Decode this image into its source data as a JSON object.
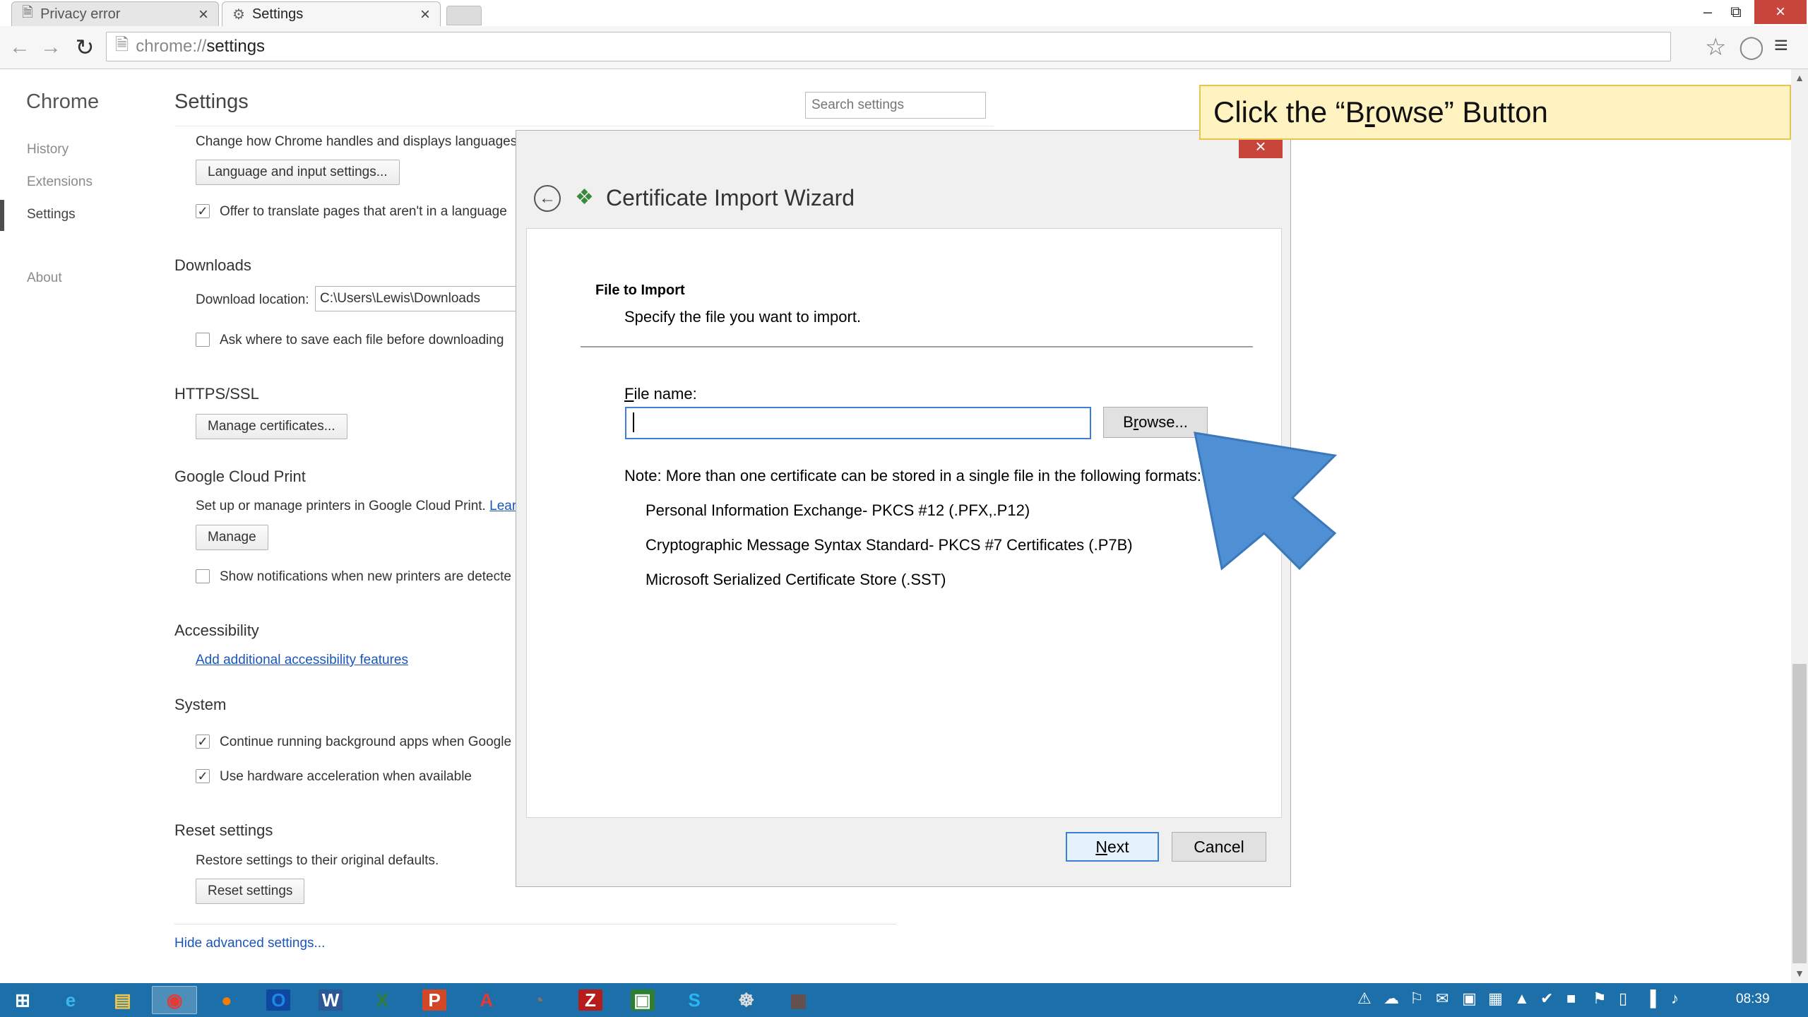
{
  "tabs": [
    {
      "label": "Privacy error",
      "icon": "page-icon"
    },
    {
      "label": "Settings",
      "icon": "gear-icon"
    }
  ],
  "omnibox": {
    "scheme": "chrome://",
    "host": "settings"
  },
  "nav": {
    "title": "Chrome",
    "items": [
      {
        "label": "History"
      },
      {
        "label": "Extensions"
      },
      {
        "label": "Settings"
      },
      {
        "label": "About"
      }
    ]
  },
  "settings": {
    "title": "Settings",
    "search_placeholder": "Search settings",
    "languages": {
      "desc": "Change how Chrome handles and displays languages.",
      "button": "Language and input settings...",
      "translate_checkbox": "Offer to translate pages that aren't in a language"
    },
    "downloads": {
      "heading": "Downloads",
      "location_label": "Download location:",
      "location_value": "C:\\Users\\Lewis\\Downloads",
      "ask_checkbox": "Ask where to save each file before downloading"
    },
    "https": {
      "heading": "HTTPS/SSL",
      "button": "Manage certificates..."
    },
    "cloud_print": {
      "heading": "Google Cloud Print",
      "desc": "Set up or manage printers in Google Cloud Print.",
      "link": "Lear",
      "button": "Manage",
      "notify_checkbox": "Show notifications when new printers are detecte"
    },
    "accessibility": {
      "heading": "Accessibility",
      "link": "Add additional accessibility features"
    },
    "system": {
      "heading": "System",
      "background_checkbox": "Continue running background apps when Google",
      "hw_checkbox": "Use hardware acceleration when available"
    },
    "reset": {
      "heading": "Reset settings",
      "desc": "Restore settings to their original defaults.",
      "button": "Reset settings"
    },
    "hide_advanced": "Hide advanced settings..."
  },
  "dialog": {
    "title": "Certificate Import Wizard",
    "section_heading": "File to Import",
    "section_desc": "Specify the file you want to import.",
    "file_label_mnemonic": "F",
    "file_label_rest": "ile name:",
    "file_value": "",
    "browse_pre": "B",
    "browse_mnemonic": "r",
    "browse_post": "owse...",
    "note": "Note:  More than one certificate can be stored in a single file in the following formats:",
    "formats": [
      "Personal Information Exchange- PKCS #12 (.PFX,.P12)",
      "Cryptographic Message Syntax Standard- PKCS #7 Certificates (.P7B)",
      "Microsoft Serialized Certificate Store (.SST)"
    ],
    "next_mnemonic": "N",
    "next_rest": "ext",
    "cancel": "Cancel"
  },
  "callout": {
    "pre": "Click the “B",
    "mnemonic": "r",
    "post": "owse” Button"
  },
  "taskbar": {
    "apps": [
      "windows-start-icon",
      "internet-explorer-icon",
      "file-explorer-icon",
      "chrome-icon",
      "firefox-icon",
      "outlook-icon",
      "word-icon",
      "excel-icon",
      "powerpoint-icon",
      "acrobat-icon",
      "gimp-icon",
      "filezilla-icon",
      "project-icon",
      "skype-icon",
      "network-icon",
      "media-icon"
    ],
    "clock": "08:39"
  },
  "colors": {
    "accent": "#3c7fd8",
    "close_red": "#c7453a",
    "taskbar": "#1c6fa8",
    "callout_bg": "#fff3c2",
    "arrow": "#4f8fd3"
  }
}
